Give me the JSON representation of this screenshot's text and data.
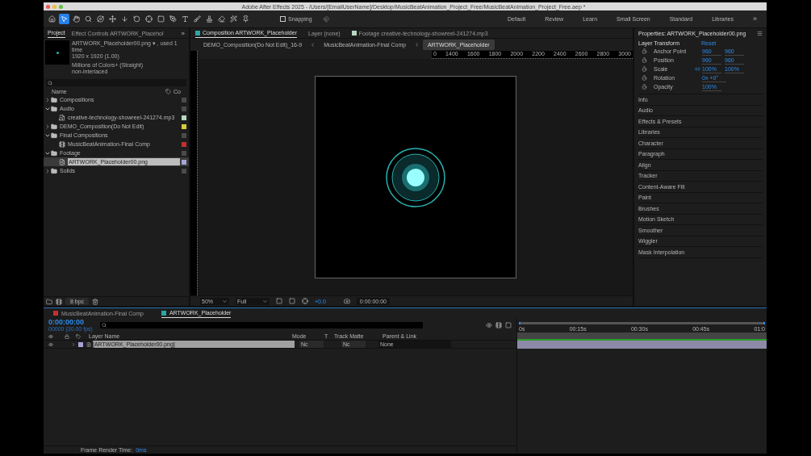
{
  "window": {
    "title": "Adobe After Effects 2025 - /Users/[EmailUserName]/Desktop/MusicBeatAnimation_Project_Free/MusicBeatAnimation_Project_Free.aep *"
  },
  "toolbar": {
    "tools": [
      {
        "kind": "home",
        "selected": false
      },
      {
        "kind": "selection",
        "selected": true
      },
      {
        "kind": "hand",
        "selected": false
      },
      {
        "kind": "zoom",
        "selected": false
      },
      {
        "kind": "orbit",
        "selected": false
      },
      {
        "kind": "move",
        "selected": false
      },
      {
        "kind": "dolly",
        "selected": false
      },
      {
        "kind": "rotate",
        "selected": false
      },
      {
        "kind": "anchor",
        "selected": false
      },
      {
        "kind": "shape",
        "selected": false
      },
      {
        "kind": "pen",
        "selected": false
      },
      {
        "kind": "type",
        "selected": false
      },
      {
        "kind": "brush",
        "selected": false
      },
      {
        "kind": "stamp",
        "selected": false
      },
      {
        "kind": "eraser",
        "selected": false
      },
      {
        "kind": "roto",
        "selected": false
      },
      {
        "kind": "puppet",
        "selected": false
      }
    ],
    "snapping": {
      "label": "Snapping",
      "checked": false
    },
    "workspaces": [
      "Default",
      "Review",
      "Learn",
      "Small Screen",
      "Standard",
      "Libraries"
    ],
    "overflow": "»"
  },
  "project_panel": {
    "tabs": [
      {
        "label": "Project",
        "selected": true
      },
      {
        "label": "Effect Controls ARTWORK_Placehol",
        "selected": false
      }
    ],
    "overflow": "»",
    "info": [
      "ARTWORK_Placeholder00.png ▾ , used 1 time",
      "1920 x 1920 (1.00)",
      "Millions of Colors+ (Straight)",
      "non-interlaced"
    ],
    "columns": [
      "Name",
      "Co"
    ],
    "items": [
      {
        "kind": "folder",
        "name": "Compositions",
        "expanded": false,
        "selected": false,
        "color": "#4a4a4a"
      },
      {
        "kind": "folder",
        "name": "Audio",
        "expanded": true,
        "selected": false,
        "color": "#4a4a4a",
        "children": [
          {
            "kind": "audio",
            "name": "creative-technology-showreel-241274.mp3",
            "selected": false,
            "color": "#b9d6c3"
          }
        ]
      },
      {
        "kind": "folder",
        "name": "DEMO_Composition(Do Not Edit)",
        "expanded": false,
        "selected": false,
        "color": "#d9cc3c"
      },
      {
        "kind": "folder",
        "name": "Final Compositions",
        "expanded": true,
        "selected": false,
        "color": "#4a4a4a",
        "children": [
          {
            "kind": "comp",
            "name": "MusicBeatAnimation-Final Comp",
            "selected": false,
            "color": "#c4302f"
          }
        ]
      },
      {
        "kind": "folder",
        "name": "Footage",
        "expanded": true,
        "selected": false,
        "color": "#4a4a4a",
        "children": [
          {
            "kind": "image",
            "name": "ARTWORK_Placeholder00.png",
            "selected": true,
            "color": "#a7a4d6"
          }
        ]
      },
      {
        "kind": "folder",
        "name": "Solids",
        "expanded": false,
        "selected": false,
        "color": "#4a4a4a"
      }
    ],
    "bit_depth": "8 bpc"
  },
  "composition_panel": {
    "tabs": [
      {
        "label": "Composition ARTWORK_Placeholder",
        "selected": true,
        "color": "#2aa6a6"
      },
      {
        "label": "Layer (none)",
        "selected": false
      },
      {
        "label": "Footage creative-technology-showreel-241274.mp3",
        "selected": false,
        "color": "#b9d6c3"
      }
    ],
    "breadcrumbs": [
      {
        "label": "DEMO_Composition(Do Not Edit)_16-9",
        "selected": false
      },
      {
        "label": "MusicBeatAnimation-Final Comp",
        "selected": false
      },
      {
        "label": "ARTWORK_Placeholder",
        "selected": true
      }
    ],
    "ruler": [
      "0",
      "1400",
      "1600",
      "1800",
      "2000",
      "2200",
      "2400",
      "2600",
      "2800",
      "3000"
    ],
    "zoom": "50%",
    "resolution": "Full",
    "exposure": "+0.0",
    "timecode": "0:00:00:00"
  },
  "properties_panel": {
    "title": "Properties: ARTWORK_Placeholder00.png",
    "section": "Layer Transform",
    "reset": "Reset",
    "properties": [
      {
        "name": "Anchor Point",
        "values": [
          "960",
          "960"
        ],
        "linked": false
      },
      {
        "name": "Position",
        "values": [
          "960",
          "960"
        ],
        "linked": false
      },
      {
        "name": "Scale",
        "values": [
          "100%",
          "100%"
        ],
        "linked": true
      },
      {
        "name": "Rotation",
        "values": [
          "0x +0°"
        ],
        "linked": false
      },
      {
        "name": "Opacity",
        "values": [
          "100%"
        ],
        "linked": false
      }
    ],
    "panels": [
      "Info",
      "Audio",
      "Effects & Presets",
      "Libraries",
      "Character",
      "Paragraph",
      "Align",
      "Tracker",
      "Content-Aware Fill",
      "Paint",
      "Brushes",
      "Motion Sketch",
      "Smoother",
      "Wiggler",
      "Mask Interpolation"
    ]
  },
  "timeline": {
    "tabs": [
      {
        "label": "MusicBeatAnimation-Final Comp",
        "selected": false,
        "color": "#c4302f"
      },
      {
        "label": "ARTWORK_Placeholder",
        "selected": true,
        "color": "#2aa6a6"
      }
    ],
    "timecode": "0:00:00:00",
    "frames": "00000 (30.00 fps)",
    "columns": {
      "layer_name": "Layer Name",
      "mode": "Mode",
      "t": "T",
      "track_matte": "Track Matte",
      "parent": "Parent & Link"
    },
    "layers": [
      {
        "name": "[ARTWORK_Placeholder00.png]",
        "color": "#a7a4d6",
        "selected": true,
        "mode": "Nc",
        "matte": "Nc",
        "parent": "None"
      }
    ],
    "time_ruler": [
      "0s",
      "00:15s",
      "00:30s",
      "00:45s",
      "01:0"
    ],
    "render_time_label": "Frame Render Time:",
    "render_time": "0ms"
  }
}
